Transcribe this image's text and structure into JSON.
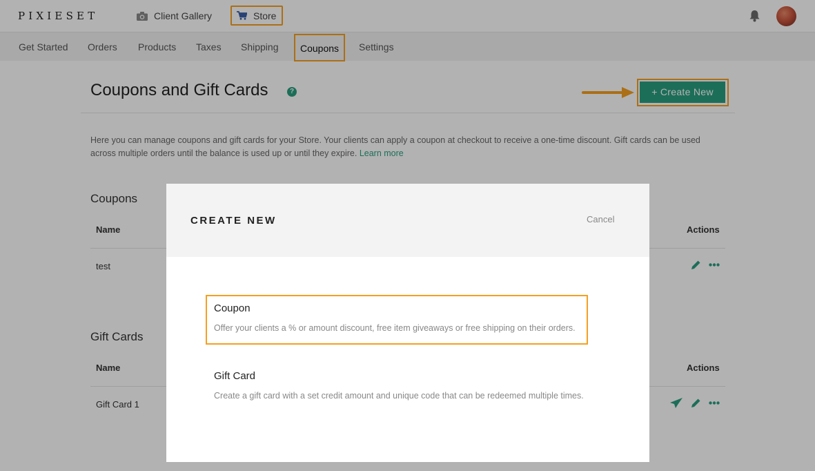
{
  "app": {
    "logo": "PIXIESET"
  },
  "topnav": {
    "gallery_label": "Client Gallery",
    "store_label": "Store"
  },
  "subnav": {
    "items": [
      "Get Started",
      "Orders",
      "Products",
      "Taxes",
      "Shipping",
      "Coupons",
      "Settings"
    ],
    "active": "Coupons"
  },
  "page": {
    "title": "Coupons and Gift Cards",
    "help": "?",
    "create_button": "+ Create New",
    "intro": "Here you can manage coupons and gift cards for your Store. Your clients can apply a coupon at checkout to receive a one-time discount. Gift cards can be used across multiple orders until the balance is used up or until they expire.",
    "learn_more": "Learn more"
  },
  "coupons": {
    "title": "Coupons",
    "col_name": "Name",
    "col_actions": "Actions",
    "rows": [
      {
        "name": "test"
      }
    ]
  },
  "gift_cards": {
    "title": "Gift Cards",
    "col_name": "Name",
    "col_actions": "Actions",
    "rows": [
      {
        "name": "Gift Card 1"
      }
    ]
  },
  "modal": {
    "title": "CREATE NEW",
    "cancel": "Cancel",
    "options": [
      {
        "title": "Coupon",
        "desc": "Offer your clients a % or amount discount, free item giveaways or free shipping on their orders."
      },
      {
        "title": "Gift Card",
        "desc": "Create a gift card with a set credit amount and unique code that can be redeemed multiple times."
      }
    ]
  },
  "colors": {
    "accent": "#2a9e7e",
    "highlight": "#f5a020"
  }
}
